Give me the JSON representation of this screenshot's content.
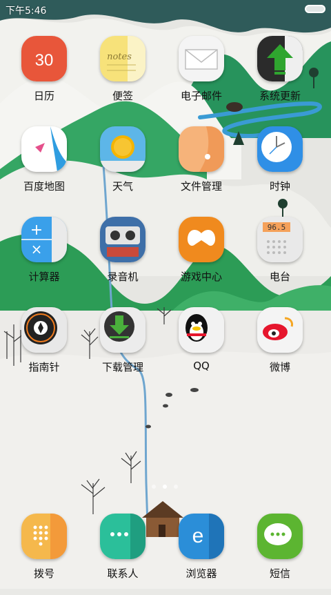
{
  "status_bar": {
    "time": "下午5:46"
  },
  "apps": [
    {
      "label": "日历",
      "icon": "calendar-icon",
      "badge_text": "30"
    },
    {
      "label": "便签",
      "icon": "notes-icon",
      "badge_text": "notes"
    },
    {
      "label": "电子邮件",
      "icon": "email-icon"
    },
    {
      "label": "系统更新",
      "icon": "system-update-icon"
    },
    {
      "label": "百度地图",
      "icon": "baidu-map-icon"
    },
    {
      "label": "天气",
      "icon": "weather-sun-icon"
    },
    {
      "label": "文件管理",
      "icon": "file-manager-icon"
    },
    {
      "label": "时钟",
      "icon": "clock-icon"
    },
    {
      "label": "计算器",
      "icon": "calculator-icon"
    },
    {
      "label": "录音机",
      "icon": "recorder-icon"
    },
    {
      "label": "游戏中心",
      "icon": "game-center-icon"
    },
    {
      "label": "电台",
      "icon": "radio-icon",
      "badge_text": "96.5"
    },
    {
      "label": "指南针",
      "icon": "compass-icon"
    },
    {
      "label": "下载管理",
      "icon": "download-manager-icon"
    },
    {
      "label": "QQ",
      "icon": "qq-penguin-icon"
    },
    {
      "label": "微博",
      "icon": "weibo-icon"
    }
  ],
  "dock": [
    {
      "label": "拨号",
      "icon": "dialer-icon"
    },
    {
      "label": "联系人",
      "icon": "contacts-icon"
    },
    {
      "label": "浏览器",
      "icon": "browser-icon"
    },
    {
      "label": "短信",
      "icon": "messages-icon"
    }
  ],
  "page_indicator": {
    "pages": 3,
    "current": 2
  },
  "colors": {
    "accent_green": "#2e9e5a",
    "calendar_red": "#e8563a",
    "update_green": "#2fa52f",
    "qq_yellow": "#f5c400",
    "weibo_red": "#e6162d",
    "sms_green": "#5cb531",
    "browser_blue": "#2b8ed8"
  }
}
